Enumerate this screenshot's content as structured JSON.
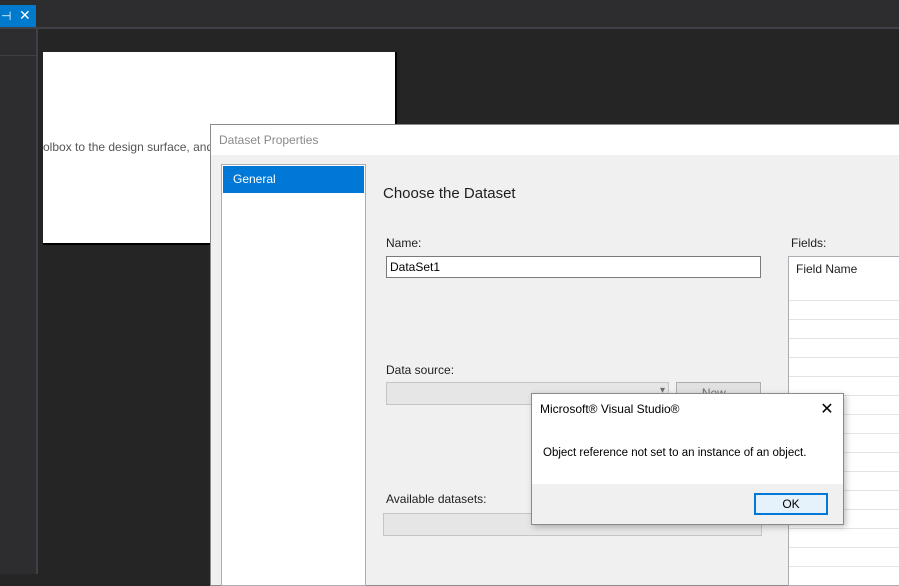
{
  "ide": {
    "pin_icon": "pin-icon",
    "close_icon": "close-icon",
    "design_hint": "olbox to the design surface, and t"
  },
  "dataset_dialog": {
    "title": "Dataset Properties",
    "nav_items": [
      {
        "label": "General",
        "selected": true
      }
    ],
    "heading": "Choose the Dataset",
    "name_label": "Name:",
    "name_value": "DataSet1",
    "data_source_label": "Data source:",
    "data_source_value": "",
    "new_button_label": "New...",
    "available_datasets_label": "Available datasets:",
    "available_datasets_value": "",
    "fields_label": "Fields:",
    "fields_column_header": "Field Name"
  },
  "message_box": {
    "title": "Microsoft® Visual Studio®",
    "message": "Object reference not set to an instance of an object.",
    "ok_label": "OK"
  },
  "colors": {
    "accent": "#0078d7",
    "ide_background": "#252526",
    "dialog_background": "#f0f0f0"
  }
}
